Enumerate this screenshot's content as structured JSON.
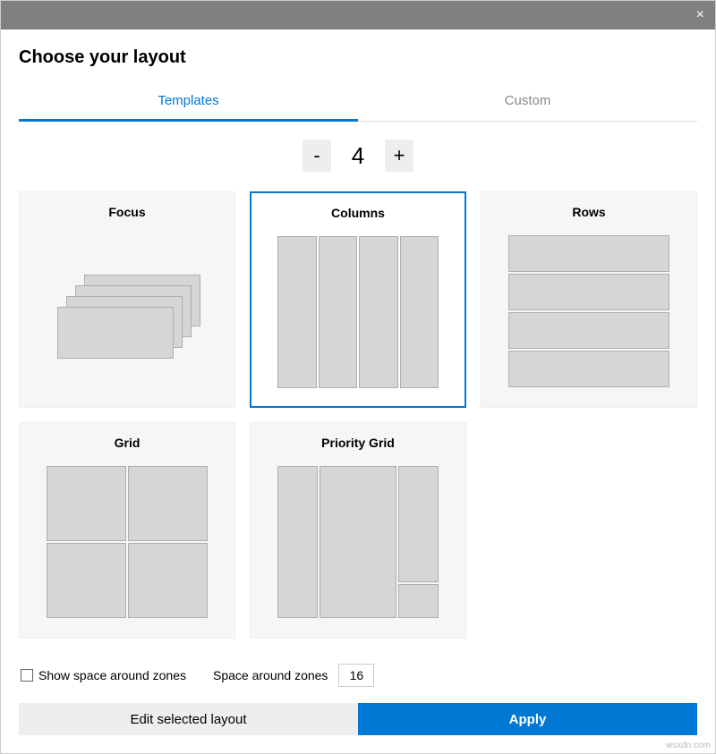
{
  "header": {
    "title": "Choose your layout"
  },
  "tabs": {
    "templates": "Templates",
    "custom": "Custom",
    "active": "templates"
  },
  "counter": {
    "minus": "-",
    "plus": "+",
    "value": "4"
  },
  "layouts": {
    "focus": "Focus",
    "columns": "Columns",
    "rows": "Rows",
    "grid": "Grid",
    "priority_grid": "Priority Grid",
    "selected": "columns"
  },
  "options": {
    "show_space_label": "Show space around zones",
    "show_space_checked": false,
    "space_label": "Space around zones",
    "space_value": "16"
  },
  "buttons": {
    "edit": "Edit selected layout",
    "apply": "Apply"
  },
  "watermark": "wsxdn.com"
}
